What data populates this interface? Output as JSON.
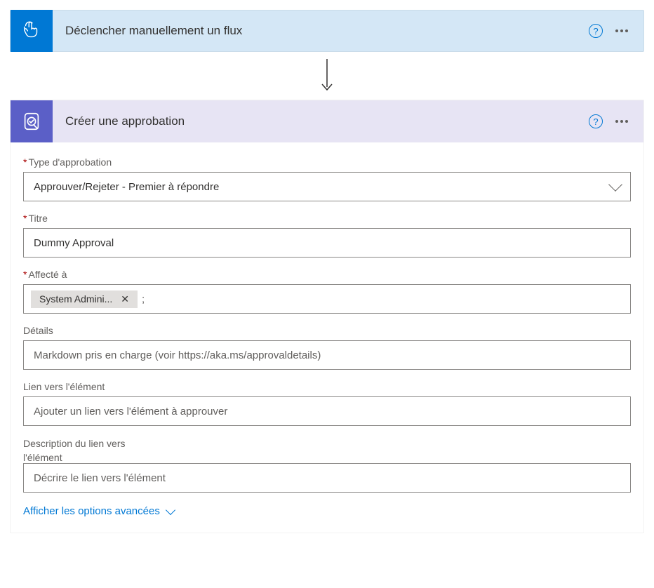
{
  "trigger": {
    "title": "Déclencher manuellement un flux"
  },
  "action": {
    "title": "Créer une approbation",
    "advanced_options_label": "Afficher les options avancées"
  },
  "form": {
    "approval_type": {
      "label": "Type d'approbation",
      "value": "Approuver/Rejeter - Premier à répondre"
    },
    "title": {
      "label": "Titre",
      "value": "Dummy Approval"
    },
    "assigned_to": {
      "label": "Affecté à",
      "token": "System Admini...",
      "separator": ";"
    },
    "details": {
      "label": "Détails",
      "placeholder": "Markdown pris en charge (voir https://aka.ms/approvaldetails)"
    },
    "item_link": {
      "label": "Lien vers l'élément",
      "placeholder": "Ajouter un lien vers l'élément à approuver"
    },
    "item_link_desc": {
      "label": "Description du lien vers l'élément",
      "placeholder": "Décrire le lien vers l'élément"
    }
  }
}
